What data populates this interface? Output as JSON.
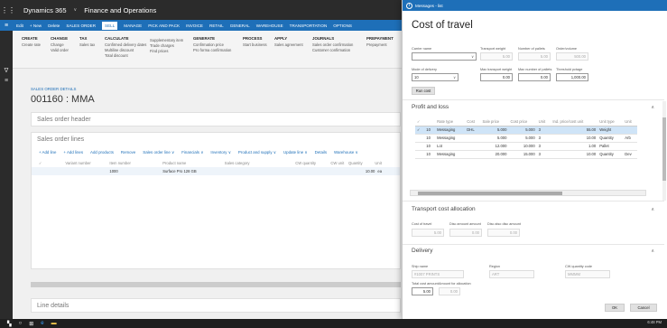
{
  "nav": {
    "title": "Dynamics 365",
    "module": "Finance and Operations"
  },
  "action_pane": {
    "items": [
      "Edit",
      "+ New",
      "Delete",
      "SALES ORDER",
      "SELL",
      "MANAGE",
      "PICK AND PACK",
      "INVOICE",
      "RETAIL",
      "GENERAL",
      "WAREHOUSE",
      "TRANSPORTATION",
      "OPTIONS"
    ]
  },
  "ribbon": {
    "groups": [
      {
        "title": "CREATE",
        "items": [
          "Create rate"
        ]
      },
      {
        "title": "CHANGE",
        "items": [
          "Change",
          "Valid order"
        ]
      },
      {
        "title": "TAX",
        "items": [
          "Sales tax"
        ]
      },
      {
        "title": "CALCULATE",
        "items": [
          "Confirmed delivery dates",
          "Multiline discount",
          "Total discount"
        ]
      },
      {
        "title": "",
        "items": [
          "Supplementary item",
          "Trade charges",
          "Find prices"
        ]
      },
      {
        "title": "GENERATE",
        "items": [
          "Confirmation price",
          "Pro forma confirmation"
        ]
      },
      {
        "title": "PROCESS",
        "items": [
          "Start business"
        ]
      },
      {
        "title": "APPLY",
        "items": [
          "Sales agreement"
        ]
      },
      {
        "title": "JOURNALS",
        "items": [
          "Sales order confirmation",
          "Customer confirmation"
        ]
      },
      {
        "title": "PREPAYMENT",
        "items": [
          "Prepayment"
        ]
      }
    ]
  },
  "page": {
    "breadcrumb": "SALES ORDER DETAILS",
    "title": "001160 : MMA",
    "header_card": "Sales order header",
    "lines_card": "Sales order lines",
    "line_toolbar": [
      "+ Add line",
      "+ Add lines",
      "Add products",
      "Remove",
      "Sales order line ∨",
      "Financials ∨",
      "Inventory ∨",
      "Product and supply ∨",
      "Update line ∨",
      "Details",
      "Warehouse ∨"
    ],
    "line_headers": [
      "Variant number",
      "Item number",
      "Product name",
      "Sales category",
      "CW quantity",
      "CW unit",
      "Quantity",
      "Unit"
    ],
    "line_row": {
      "item": "1000",
      "product": "Surface Pro 128 GB",
      "qty": "10.00",
      "unit": "ea"
    },
    "line_details": "Line details"
  },
  "dialog": {
    "tab": "Messages - list",
    "heading": "Cost of travel",
    "fields": {
      "carrier_label": "Carrier name",
      "transport_weight_label": "Transport weight",
      "pallets_label": "Number of pallets",
      "order_volume_label": "Order/volume",
      "transport_weight": "5.00",
      "pallets": "5.00",
      "order_volume": "500.00",
      "mode_label": "Mode of delivery",
      "mode_value": "10",
      "max_weight_label": "Max transport weight",
      "max_pallets_label": "Max number of pallets",
      "threshold_label": "Threshold pctage",
      "max_weight": "0.00",
      "max_pallets": "0.00",
      "threshold": "1,000.00",
      "run_button": "Run cost"
    },
    "profit_section": "Profit and loss",
    "grid": {
      "headers": [
        "",
        "",
        "Rate type",
        "Cost",
        "Sale price",
        "Cost price",
        "Unit",
        "Ind. price/cost unit",
        "Unit type",
        "Unit"
      ],
      "rows": [
        {
          "c1": "10",
          "c2": "Messaging",
          "c3": "DHL",
          "c4": "5.000",
          "c5": "5.000",
          "c6": "3",
          "c7": "55.00",
          "c8": "Weight",
          "c9": ""
        },
        {
          "c1": "10",
          "c2": "Messaging",
          "c3": "",
          "c4": "5.000",
          "c5": "5.000",
          "c6": "3",
          "c7": "10.00",
          "c8": "Quantity",
          "c9": "Arb"
        },
        {
          "c1": "10",
          "c2": "Lot",
          "c3": "",
          "c4": "12.000",
          "c5": "10.000",
          "c6": "3",
          "c7": "1.00",
          "c8": "Pallet",
          "c9": ""
        },
        {
          "c1": "10",
          "c2": "Messaging",
          "c3": "",
          "c4": "20.000",
          "c5": "15.000",
          "c6": "3",
          "c7": "10.00",
          "c8": "Quantity",
          "c9": "Dev"
        }
      ]
    },
    "transport_section": "Transport cost allocation",
    "transport": {
      "cost_label": "Cost of travel",
      "disc_label": "Disc amount amount",
      "disc2_label": "Disc also disc amount",
      "cost": "5.00",
      "disc": "0.00",
      "disc2": "0.00"
    },
    "delivery_section": "Delivery",
    "delivery": {
      "ship_label": "Ship name",
      "ship_value": "#1007 PRINTS",
      "region_label": "Region",
      "region_value": "ART",
      "cw_label": "CW quantity code",
      "cw_value": "MMMM",
      "cost_label": "Total cost amount",
      "alloc_label": "Amount for allocation",
      "cost_value": "5.00",
      "alloc_value": "0.00"
    },
    "ok_button": "OK",
    "cancel_button": "Cancel"
  },
  "taskbar": {
    "clock": "6:48 PM"
  }
}
